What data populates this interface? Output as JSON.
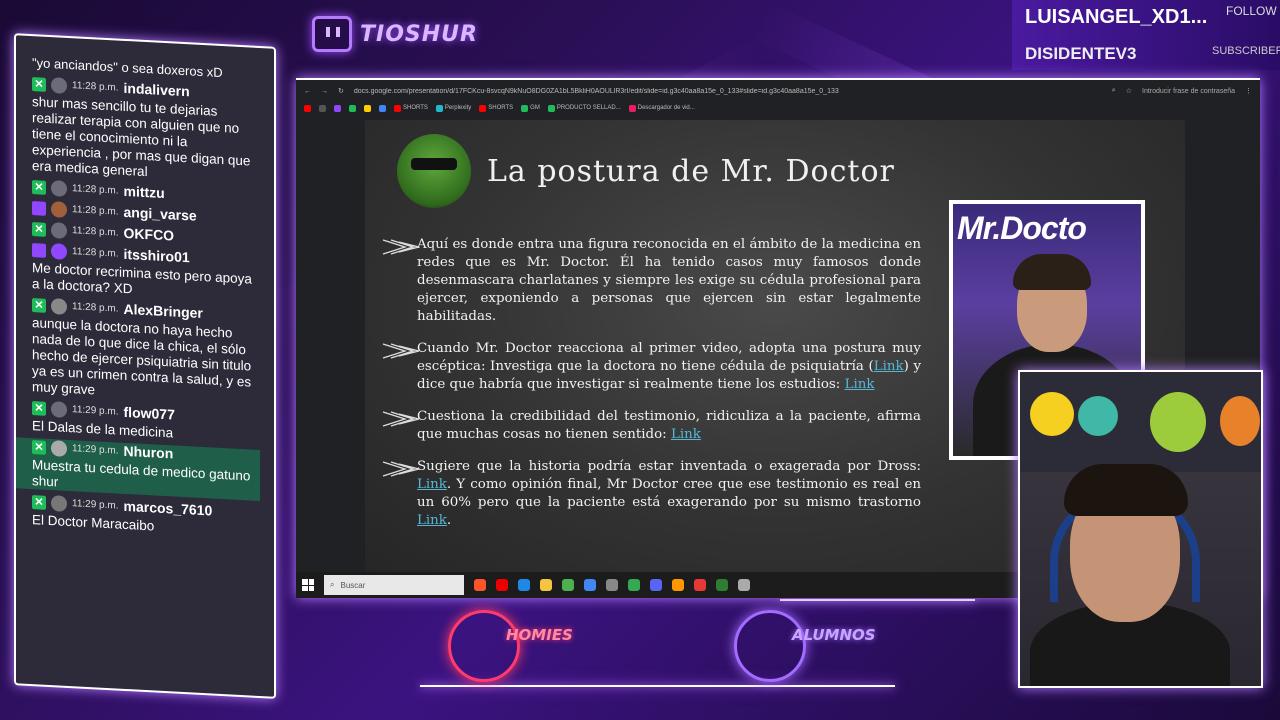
{
  "brand": {
    "name": "TIOSHUR"
  },
  "alerts": {
    "follow_name": "LUISANGEL_XD1...",
    "follow_label": "FOLLOW",
    "sub_name": "DISIDENTEV3",
    "sub_label": "SUBSCRIBER"
  },
  "chat": [
    {
      "msg": "sea doxeros xD",
      "prefix": "\"yo anciandos\" o"
    },
    {
      "time": "11:28 p.m.",
      "user": "indalivern",
      "msg": "shur mas sencillo tu te dejarias realizar terapia con alguien que no tiene el conocimiento ni la experiencia , por mas que digan que era medica general"
    },
    {
      "time": "11:28 p.m.",
      "user": "mittzu",
      "msg": ""
    },
    {
      "time": "11:28 p.m.",
      "user": "angi_varse",
      "msg": ""
    },
    {
      "time": "11:28 p.m.",
      "user": "OKFCO",
      "msg": ""
    },
    {
      "time": "11:28 p.m.",
      "user": "itsshiro01",
      "msg": "Me doctor recrimina esto pero apoya a la doctora? XD"
    },
    {
      "time": "11:28 p.m.",
      "user": "AlexBringer",
      "msg": "aunque la doctora no haya hecho nada de lo que dice la chica, el sólo hecho de ejercer psiquiatria sin titulo ya es un crimen contra la salud, y es muy grave"
    },
    {
      "time": "11:29 p.m.",
      "user": "flow077",
      "msg": "El Dalas de la medicina"
    },
    {
      "time": "11:29 p.m.",
      "user": "Nhuron",
      "msg": "Muestra tu cedula de medico gatuno shur"
    },
    {
      "time": "11:29 p.m.",
      "user": "marcos_7610",
      "msg": "El Doctor Maracaibo"
    }
  ],
  "browser": {
    "url": "docs.google.com/presentation/d/17FCKcu-8svcqN9kNuO8DG0ZA1bL5BkliH0AOULlR3rI/edit/slide=id.g3c40aa8a15e_0_133#slide=id.g3c40aa8a15e_0_133",
    "password_hint": "Introducir frase de contraseña",
    "bookmarks": [
      "SHORTS",
      "Perplexity",
      "SHORTS",
      "GM",
      "PRODUCTO SELLAD...",
      "Descargador de vid..."
    ]
  },
  "slide": {
    "title": "La postura de Mr. Doctor",
    "photo_logo": "Mr.Docto",
    "bullets": [
      {
        "text": "Aquí es donde entra una figura reconocida en el ámbito de la medicina en redes que es Mr. Doctor. Él ha tenido casos muy famosos donde desenmascara charlatanes y siempre les exige su cédula profesional para ejercer, exponiendo a personas que ejercen sin estar legalmente habilitadas."
      },
      {
        "pre": "Cuando Mr. Doctor reacciona al primer video, adopta una postura muy escéptica: Investiga que la doctora no tiene cédula de psiquiatría (",
        "link1": "Link",
        "mid": ") y dice que habría que investigar si realmente tiene los estudios: ",
        "link2": "Link"
      },
      {
        "pre": "Cuestiona la credibilidad del testimonio, ridiculiza a la paciente, afirma que muchas cosas no tienen sentido: ",
        "link1": "Link"
      },
      {
        "pre": "Sugiere que la historia podría estar inventada o exagerada por Dross: ",
        "link1": "Link",
        "mid": ". Y como opinión final, Mr Doctor cree que ese testimonio es real en un 60% pero que la paciente está exagerando por su mismo trastorno ",
        "link2": "Link",
        "post": "."
      }
    ]
  },
  "taskbar": {
    "search_placeholder": "Buscar"
  },
  "bottom": {
    "left_label": "HOMIES",
    "right_label": "ALUMNOS"
  },
  "colors": {
    "accent": "#9b4dff",
    "link": "#55b7d6",
    "chat_highlight": "#1f5f4a",
    "bg": "#2a0f55"
  }
}
